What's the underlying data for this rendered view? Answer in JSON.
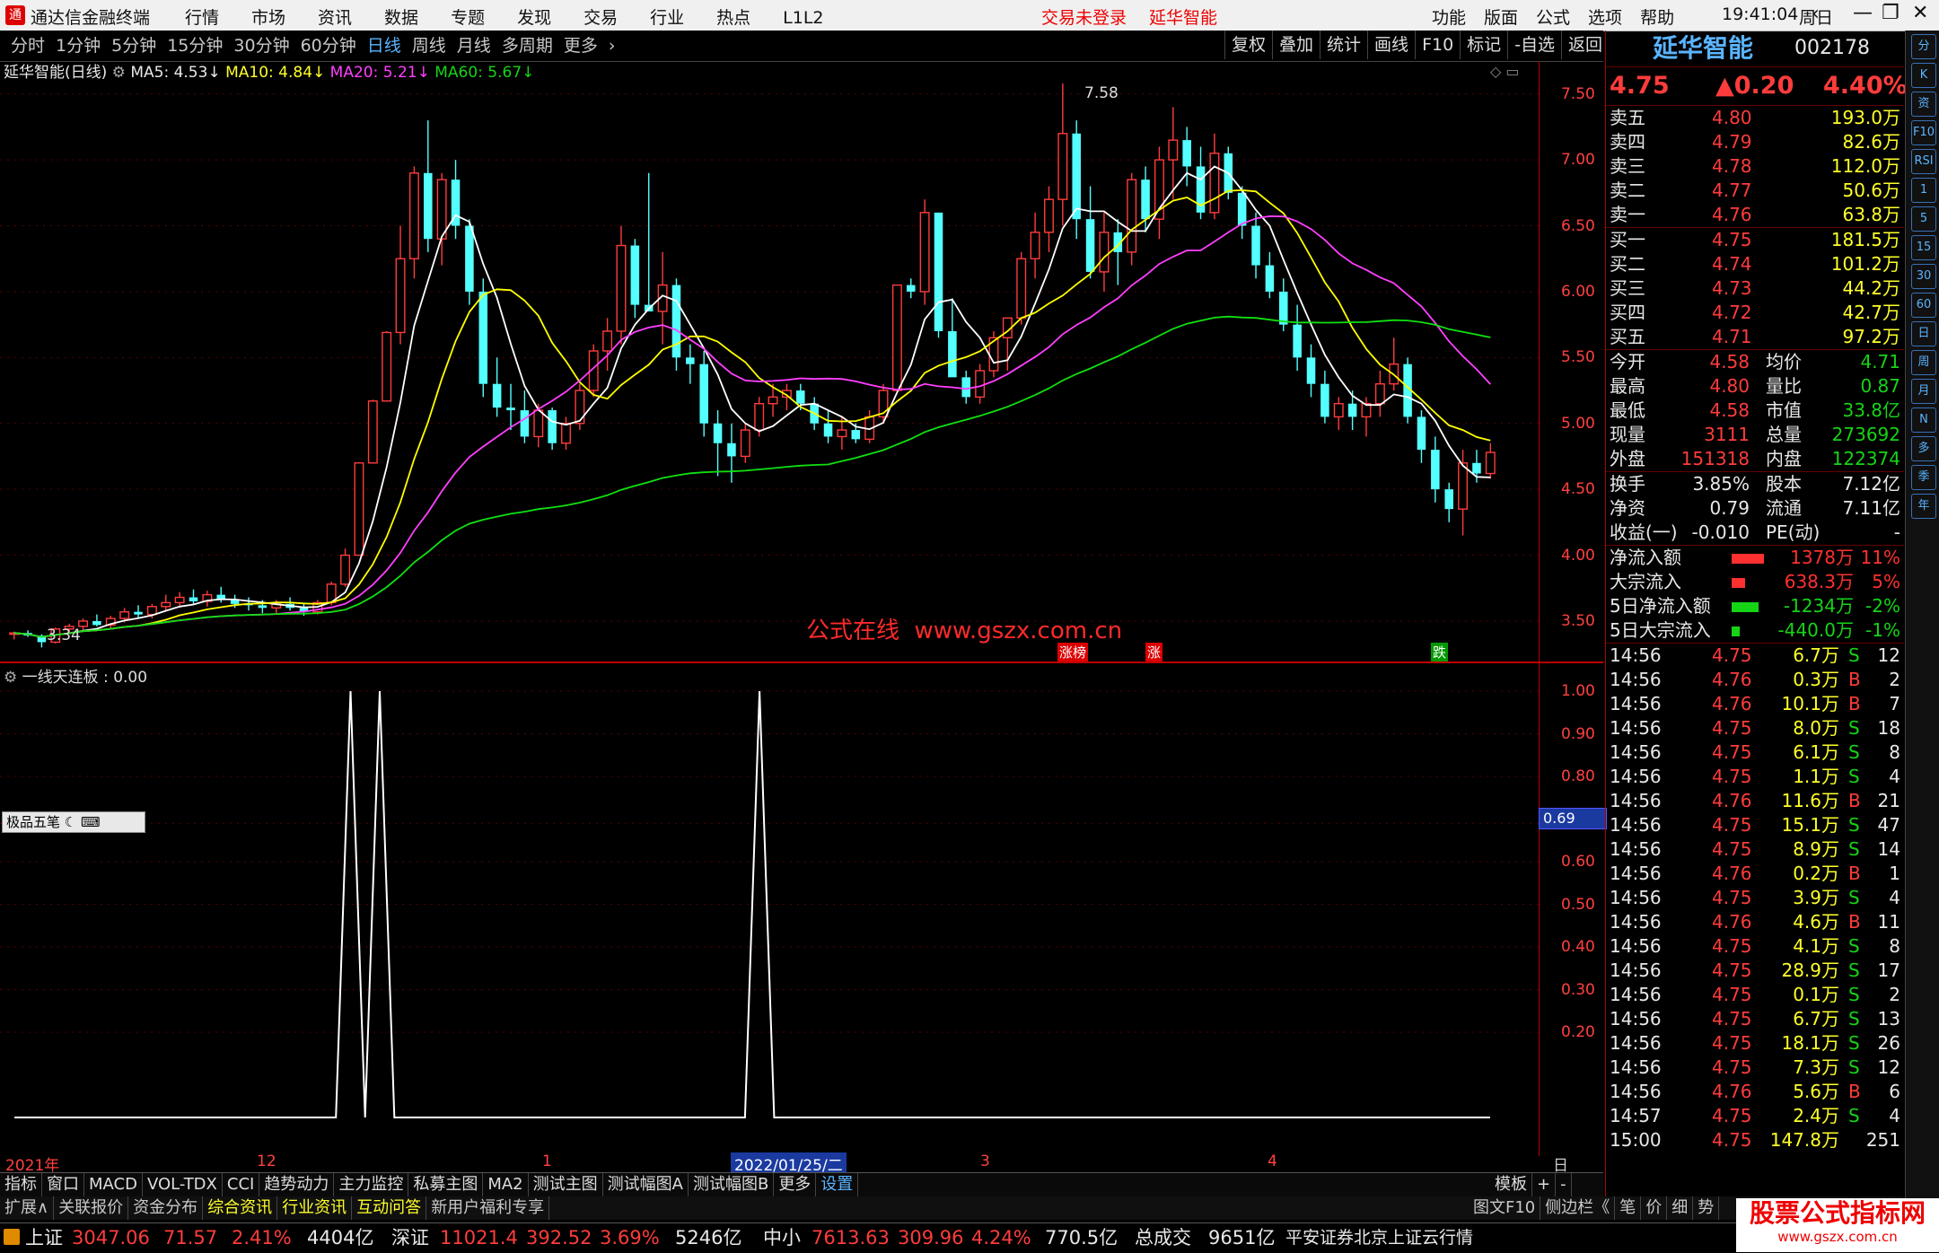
{
  "app": {
    "title": "通达信金融终端",
    "menu": [
      "行情",
      "市场",
      "资讯",
      "数据",
      "专题",
      "发现",
      "交易",
      "行业",
      "热点",
      "L1L2"
    ],
    "notice_left": "交易未登录",
    "notice_stock": "延华智能",
    "right_menu": [
      "功能",
      "版面",
      "公式",
      "选项",
      "帮助"
    ],
    "clock": "19:41:04",
    "weekday": "周日"
  },
  "period_bar": {
    "items": [
      "分时",
      "1分钟",
      "5分钟",
      "15分钟",
      "30分钟",
      "60分钟",
      "日线",
      "周线",
      "月线",
      "多周期",
      "更多"
    ],
    "active": "日线",
    "tools": [
      "复权",
      "叠加",
      "统计",
      "画线",
      "F10",
      "标记",
      "-自选",
      "返回"
    ]
  },
  "chart_info": {
    "name": "延华智能(日线)",
    "ma5": "MA5: 4.53",
    "ma10": "MA10: 4.84",
    "ma20": "MA20: 5.21",
    "ma60": "MA60: 5.67",
    "colors": {
      "ma5": "#ffffff",
      "ma10": "#ffff00",
      "ma20": "#ff40ff",
      "ma60": "#10e010"
    }
  },
  "main_chart": {
    "high_label": "7.58",
    "low_label": "3.34",
    "watermark": "公式在线  www.gszx.com.cn",
    "markers": [
      "涨榜",
      "涨",
      "跌"
    ],
    "y_ticks": [
      "7.50",
      "7.00",
      "6.50",
      "6.00",
      "5.50",
      "5.00",
      "4.50",
      "4.00",
      "3.50"
    ]
  },
  "sub_chart": {
    "title": "一线天连板 : 0.00",
    "y_ticks": [
      "1.00",
      "0.90",
      "0.80",
      "0.69",
      "0.60",
      "0.50",
      "0.40",
      "0.30",
      "0.20"
    ],
    "cursor_value": "0.69",
    "toolbox": "极品五笔"
  },
  "chart_data": [
    {
      "type": "candlestick",
      "y_range": [
        3.2,
        7.75
      ],
      "candles": [
        [
          3.4,
          3.42,
          3.36,
          3.41
        ],
        [
          3.41,
          3.43,
          3.38,
          3.39
        ],
        [
          3.39,
          3.4,
          3.3,
          3.34
        ],
        [
          3.34,
          3.45,
          3.33,
          3.44
        ],
        [
          3.44,
          3.48,
          3.41,
          3.46
        ],
        [
          3.46,
          3.52,
          3.43,
          3.5
        ],
        [
          3.5,
          3.55,
          3.46,
          3.47
        ],
        [
          3.47,
          3.54,
          3.44,
          3.52
        ],
        [
          3.52,
          3.6,
          3.49,
          3.57
        ],
        [
          3.57,
          3.62,
          3.52,
          3.55
        ],
        [
          3.55,
          3.63,
          3.52,
          3.61
        ],
        [
          3.61,
          3.7,
          3.58,
          3.64
        ],
        [
          3.64,
          3.72,
          3.6,
          3.68
        ],
        [
          3.68,
          3.74,
          3.63,
          3.65
        ],
        [
          3.65,
          3.73,
          3.61,
          3.7
        ],
        [
          3.7,
          3.76,
          3.64,
          3.66
        ],
        [
          3.66,
          3.7,
          3.6,
          3.63
        ],
        [
          3.63,
          3.68,
          3.58,
          3.62
        ],
        [
          3.62,
          3.66,
          3.56,
          3.6
        ],
        [
          3.6,
          3.66,
          3.56,
          3.63
        ],
        [
          3.63,
          3.68,
          3.58,
          3.6
        ],
        [
          3.6,
          3.64,
          3.54,
          3.57
        ],
        [
          3.57,
          3.66,
          3.55,
          3.64
        ],
        [
          3.64,
          3.8,
          3.62,
          3.78
        ],
        [
          3.78,
          4.05,
          3.76,
          4.0
        ],
        [
          4.0,
          4.7,
          4.0,
          4.7
        ],
        [
          4.7,
          5.18,
          4.7,
          5.17
        ],
        [
          5.17,
          5.7,
          5.17,
          5.69
        ],
        [
          5.69,
          6.5,
          5.6,
          6.25
        ],
        [
          6.25,
          6.95,
          6.1,
          6.9
        ],
        [
          6.9,
          7.3,
          6.3,
          6.4
        ],
        [
          6.4,
          6.9,
          6.2,
          6.85
        ],
        [
          6.85,
          7.0,
          6.4,
          6.5
        ],
        [
          6.5,
          6.55,
          5.9,
          6.0
        ],
        [
          6.0,
          6.1,
          5.2,
          5.3
        ],
        [
          5.3,
          5.5,
          5.05,
          5.12
        ],
        [
          5.12,
          5.3,
          4.95,
          5.1
        ],
        [
          5.1,
          5.25,
          4.85,
          4.9
        ],
        [
          4.9,
          5.15,
          4.82,
          5.1
        ],
        [
          5.1,
          5.12,
          4.8,
          4.85
        ],
        [
          4.85,
          5.05,
          4.8,
          5.0
        ],
        [
          5.0,
          5.3,
          4.95,
          5.25
        ],
        [
          5.25,
          5.6,
          5.2,
          5.55
        ],
        [
          5.55,
          5.8,
          5.4,
          5.7
        ],
        [
          5.7,
          6.5,
          5.6,
          6.35
        ],
        [
          6.35,
          6.4,
          5.8,
          5.9
        ],
        [
          5.9,
          6.9,
          5.85,
          5.85
        ],
        [
          5.85,
          6.3,
          5.6,
          6.05
        ],
        [
          6.05,
          6.1,
          5.4,
          5.5
        ],
        [
          5.5,
          5.6,
          5.3,
          5.45
        ],
        [
          5.45,
          5.55,
          4.9,
          5.0
        ],
        [
          5.0,
          5.1,
          4.6,
          4.85
        ],
        [
          4.85,
          5.0,
          4.55,
          4.75
        ],
        [
          4.75,
          5.0,
          4.7,
          4.95
        ],
        [
          4.95,
          5.2,
          4.9,
          5.15
        ],
        [
          5.15,
          5.3,
          5.05,
          5.2
        ],
        [
          5.2,
          5.3,
          5.1,
          5.25
        ],
        [
          5.25,
          5.3,
          5.1,
          5.15
        ],
        [
          5.15,
          5.2,
          4.95,
          5.0
        ],
        [
          5.0,
          5.1,
          4.85,
          4.9
        ],
        [
          4.9,
          5.05,
          4.8,
          4.95
        ],
        [
          4.95,
          5.0,
          4.85,
          4.88
        ],
        [
          4.88,
          5.1,
          4.85,
          5.05
        ],
        [
          5.05,
          5.3,
          5.0,
          5.25
        ],
        [
          5.25,
          6.0,
          5.25,
          6.05
        ],
        [
          6.05,
          6.1,
          5.95,
          6.0
        ],
        [
          6.0,
          6.7,
          5.9,
          6.6
        ],
        [
          6.6,
          6.1,
          5.65,
          5.7
        ],
        [
          5.7,
          5.95,
          5.4,
          5.35
        ],
        [
          5.35,
          5.4,
          5.15,
          5.2
        ],
        [
          5.2,
          5.45,
          5.15,
          5.4
        ],
        [
          5.4,
          5.7,
          5.35,
          5.65
        ],
        [
          5.65,
          5.8,
          5.4,
          5.8
        ],
        [
          5.8,
          6.3,
          5.75,
          6.25
        ],
        [
          6.25,
          6.6,
          6.1,
          6.45
        ],
        [
          6.45,
          6.8,
          6.3,
          6.7
        ],
        [
          6.7,
          7.58,
          6.5,
          7.2
        ],
        [
          7.2,
          7.3,
          6.4,
          6.55
        ],
        [
          6.55,
          6.8,
          6.1,
          6.15
        ],
        [
          6.15,
          6.6,
          6.0,
          6.45
        ],
        [
          6.45,
          6.55,
          6.05,
          6.3
        ],
        [
          6.3,
          6.9,
          6.2,
          6.85
        ],
        [
          6.85,
          6.95,
          6.45,
          6.55
        ],
        [
          6.55,
          7.1,
          6.4,
          7.0
        ],
        [
          7.0,
          7.4,
          6.7,
          7.15
        ],
        [
          7.15,
          7.25,
          6.8,
          6.95
        ],
        [
          6.95,
          7.1,
          6.55,
          6.6
        ],
        [
          6.6,
          7.2,
          6.55,
          7.05
        ],
        [
          7.05,
          7.1,
          6.7,
          6.75
        ],
        [
          6.75,
          6.8,
          6.4,
          6.5
        ],
        [
          6.5,
          6.6,
          6.1,
          6.2
        ],
        [
          6.2,
          6.3,
          5.95,
          6.0
        ],
        [
          6.0,
          6.1,
          5.7,
          5.75
        ],
        [
          5.75,
          5.9,
          5.4,
          5.5
        ],
        [
          5.5,
          5.6,
          5.2,
          5.3
        ],
        [
          5.3,
          5.4,
          5.0,
          5.05
        ],
        [
          5.05,
          5.2,
          4.95,
          5.15
        ],
        [
          5.15,
          5.25,
          4.95,
          5.05
        ],
        [
          5.05,
          5.2,
          4.9,
          5.15
        ],
        [
          5.15,
          5.4,
          5.05,
          5.3
        ],
        [
          5.3,
          5.65,
          5.25,
          5.45
        ],
        [
          5.45,
          5.5,
          5.0,
          5.05
        ],
        [
          5.05,
          5.1,
          4.7,
          4.8
        ],
        [
          4.8,
          4.9,
          4.4,
          4.5
        ],
        [
          4.5,
          4.55,
          4.25,
          4.35
        ],
        [
          4.35,
          4.8,
          4.15,
          4.7
        ],
        [
          4.7,
          4.8,
          4.55,
          4.62
        ],
        [
          4.62,
          4.85,
          4.58,
          4.78
        ]
      ]
    },
    {
      "type": "line",
      "name": "一线天连板",
      "y_range": [
        0,
        1
      ],
      "spikes_at_index": [
        23,
        25,
        51
      ],
      "length": 102
    }
  ],
  "time_axis": {
    "labels": [
      "2021年",
      "12",
      "1",
      "2022/01/25/二",
      "3",
      "4",
      "日线"
    ]
  },
  "quote": {
    "name": "延华智能",
    "code": "002178",
    "price": "4.75",
    "change": "▲0.20",
    "pct": "4.40%",
    "sells": [
      {
        "label": "卖五",
        "price": "4.80",
        "vol": "193.0万"
      },
      {
        "label": "卖四",
        "price": "4.79",
        "vol": "82.6万"
      },
      {
        "label": "卖三",
        "price": "4.78",
        "vol": "112.0万"
      },
      {
        "label": "卖二",
        "price": "4.77",
        "vol": "50.6万"
      },
      {
        "label": "卖一",
        "price": "4.76",
        "vol": "63.8万"
      }
    ],
    "buys": [
      {
        "label": "买一",
        "price": "4.75",
        "vol": "181.5万"
      },
      {
        "label": "买二",
        "price": "4.74",
        "vol": "101.2万"
      },
      {
        "label": "买三",
        "price": "4.73",
        "vol": "44.2万"
      },
      {
        "label": "买四",
        "price": "4.72",
        "vol": "42.7万"
      },
      {
        "label": "买五",
        "price": "4.71",
        "vol": "97.2万"
      }
    ],
    "stats1": [
      {
        "l1": "今开",
        "v1": "4.58",
        "l2": "均价",
        "v2": "4.71"
      },
      {
        "l1": "最高",
        "v1": "4.80",
        "l2": "量比",
        "v2": "0.87"
      },
      {
        "l1": "最低",
        "v1": "4.58",
        "l2": "市值",
        "v2": "33.8亿"
      },
      {
        "l1": "现量",
        "v1": "3111",
        "l2": "总量",
        "v2": "273692"
      },
      {
        "l1": "外盘",
        "v1": "151318",
        "l2": "内盘",
        "v2": "122374"
      }
    ],
    "stats2": [
      {
        "l1": "换手",
        "v1": "3.85%",
        "l2": "股本",
        "v2": "7.12亿"
      },
      {
        "l1": "净资",
        "v1": "0.79",
        "l2": "流通",
        "v2": "7.11亿"
      },
      {
        "l1": "收益(一)",
        "v1": "-0.010",
        "l2": "PE(动)",
        "v2": "-"
      }
    ],
    "flows": [
      {
        "label": "净流入额",
        "value": "1378万",
        "pct": "11%",
        "bar": 0.6,
        "color": "#ff3030"
      },
      {
        "label": "大宗流入",
        "value": "638.3万",
        "pct": "5%",
        "bar": 0.25,
        "color": "#ff3030"
      },
      {
        "label": "5日净流入额",
        "value": "-1234万",
        "pct": "-2%",
        "bar": 0.5,
        "color": "#16d416"
      },
      {
        "label": "5日大宗流入",
        "value": "-440.0万",
        "pct": "-1%",
        "bar": 0.15,
        "color": "#16d416"
      }
    ],
    "ticks": [
      [
        "14:56",
        "4.75",
        "6.7万",
        "S",
        "12"
      ],
      [
        "14:56",
        "4.76",
        "0.3万",
        "B",
        "2"
      ],
      [
        "14:56",
        "4.76",
        "10.1万",
        "B",
        "7"
      ],
      [
        "14:56",
        "4.75",
        "8.0万",
        "S",
        "18"
      ],
      [
        "14:56",
        "4.75",
        "6.1万",
        "S",
        "8"
      ],
      [
        "14:56",
        "4.75",
        "1.1万",
        "S",
        "4"
      ],
      [
        "14:56",
        "4.76",
        "11.6万",
        "B",
        "21"
      ],
      [
        "14:56",
        "4.75",
        "15.1万",
        "S",
        "47"
      ],
      [
        "14:56",
        "4.75",
        "8.9万",
        "S",
        "14"
      ],
      [
        "14:56",
        "4.76",
        "0.2万",
        "B",
        "1"
      ],
      [
        "14:56",
        "4.75",
        "3.9万",
        "S",
        "4"
      ],
      [
        "14:56",
        "4.76",
        "4.6万",
        "B",
        "11"
      ],
      [
        "14:56",
        "4.75",
        "4.1万",
        "S",
        "8"
      ],
      [
        "14:56",
        "4.75",
        "28.9万",
        "S",
        "17"
      ],
      [
        "14:56",
        "4.75",
        "0.1万",
        "S",
        "2"
      ],
      [
        "14:56",
        "4.75",
        "6.7万",
        "S",
        "13"
      ],
      [
        "14:56",
        "4.75",
        "18.1万",
        "S",
        "26"
      ],
      [
        "14:56",
        "4.75",
        "7.3万",
        "S",
        "12"
      ],
      [
        "14:56",
        "4.76",
        "5.6万",
        "B",
        "6"
      ],
      [
        "14:57",
        "4.75",
        "2.4万",
        "S",
        "4"
      ],
      [
        "15:00",
        "4.75",
        "147.8万",
        "",
        "251"
      ]
    ]
  },
  "bottom_tabs1": [
    "指标",
    "窗口",
    "MACD",
    "VOL-TDX",
    "CCI",
    "趋势动力",
    "主力监控",
    "私募主图",
    "MA2",
    "测试主图",
    "测试幅图A",
    "测试幅图B",
    "更多",
    "设置"
  ],
  "bottom_tabs1_right": [
    "模板",
    "+",
    "-"
  ],
  "bottom_tabs2": [
    "扩展∧",
    "关联报价",
    "资金分布",
    "综合资讯",
    "行业资讯",
    "互动问答",
    "新用户福利专享"
  ],
  "bottom_tabs2_right": [
    "图文F10",
    "侧边栏《",
    "笔",
    "价",
    "细",
    "势"
  ],
  "status": {
    "sh_label": "上证",
    "sh": "3047.06",
    "sh_chg": "71.57",
    "sh_pct": "2.41%",
    "sh_amt": "4404亿",
    "sz_label": "深证",
    "sz": "11021.4",
    "sz_chg": "392.52",
    "sz_pct": "3.69%",
    "sz_amt": "5246亿",
    "zx_label": "中小",
    "zx": "7613.63",
    "zx_chg": "309.96",
    "zx_pct": "4.24%",
    "zx_amt": "770.5亿",
    "total_label": "总成交",
    "total": "9651亿",
    "broker": "平安证券北京上证云行情",
    "logo_text": "股票公式指标网",
    "logo_url": "www.gszx.com.cn"
  },
  "side_toolbar": [
    "分",
    "K",
    "资",
    "F10",
    "RSI",
    "1",
    "5",
    "15",
    "30",
    "60",
    "日",
    "周",
    "月",
    "N",
    "多",
    "季",
    "年"
  ]
}
